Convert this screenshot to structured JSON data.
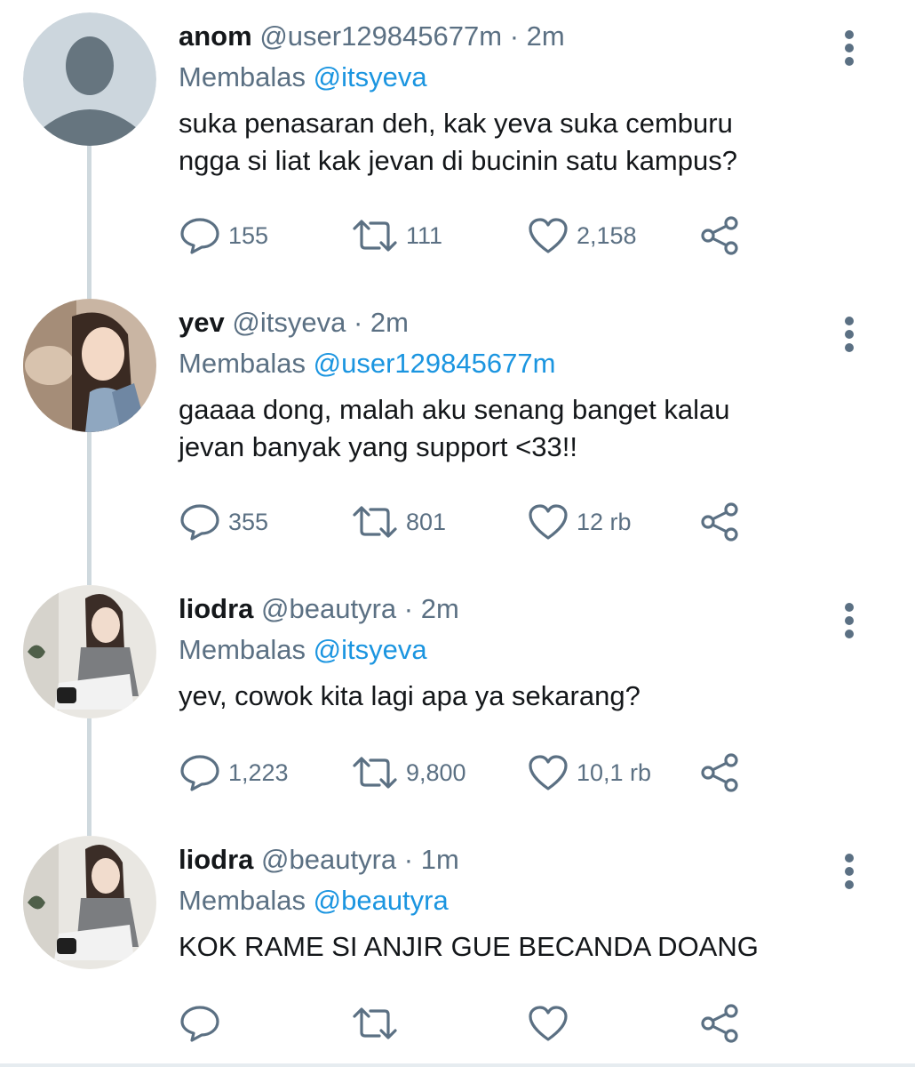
{
  "tweets": [
    {
      "display_name": "anom",
      "handle": "@user129845677m",
      "separator": "·",
      "time": "2m",
      "reply_prefix": "Membalas",
      "reply_to": "@itsyeva",
      "text_lines": [
        "suka penasaran deh, kak yeva suka cemburu",
        "ngga si liat kak jevan di bucinin satu kampus?"
      ],
      "reply_count": "155",
      "retweet_count": "111",
      "like_count": "2,158",
      "avatar_icon": "default-profile-icon"
    },
    {
      "display_name": "yev",
      "handle": "@itsyeva",
      "separator": "·",
      "time": "2m",
      "reply_prefix": "Membalas",
      "reply_to": "@user129845677m",
      "text_lines": [
        "gaaaa dong, malah aku senang banget kalau",
        "jevan banyak yang support <33!!"
      ],
      "reply_count": "355",
      "retweet_count": "801",
      "like_count": "12 rb",
      "avatar_icon": "profile-photo"
    },
    {
      "display_name": "liodra",
      "handle": "@beautyra",
      "separator": "·",
      "time": "2m",
      "reply_prefix": "Membalas",
      "reply_to": "@itsyeva",
      "text_lines": [
        "yev, cowok kita lagi apa ya sekarang?"
      ],
      "reply_count": "1,223",
      "retweet_count": "9,800",
      "like_count": "10,1 rb",
      "avatar_icon": "profile-photo"
    },
    {
      "display_name": "liodra",
      "handle": "@beautyra",
      "separator": "·",
      "time": "1m",
      "reply_prefix": "Membalas",
      "reply_to": "@beautyra",
      "text_lines": [
        "KOK RAME SI ANJIR GUE BECANDA DOANG"
      ],
      "reply_count": "",
      "retweet_count": "",
      "like_count": "",
      "avatar_icon": "profile-photo"
    }
  ],
  "icons": {
    "reply": "reply-bubble-icon",
    "retweet": "retweet-icon",
    "like": "heart-icon",
    "share": "share-icon",
    "more": "more-vertical-icon"
  },
  "colors": {
    "text_primary": "#14171a",
    "text_secondary": "#5b7083",
    "link": "#1b95e0",
    "thread_line": "#cfd9de"
  }
}
